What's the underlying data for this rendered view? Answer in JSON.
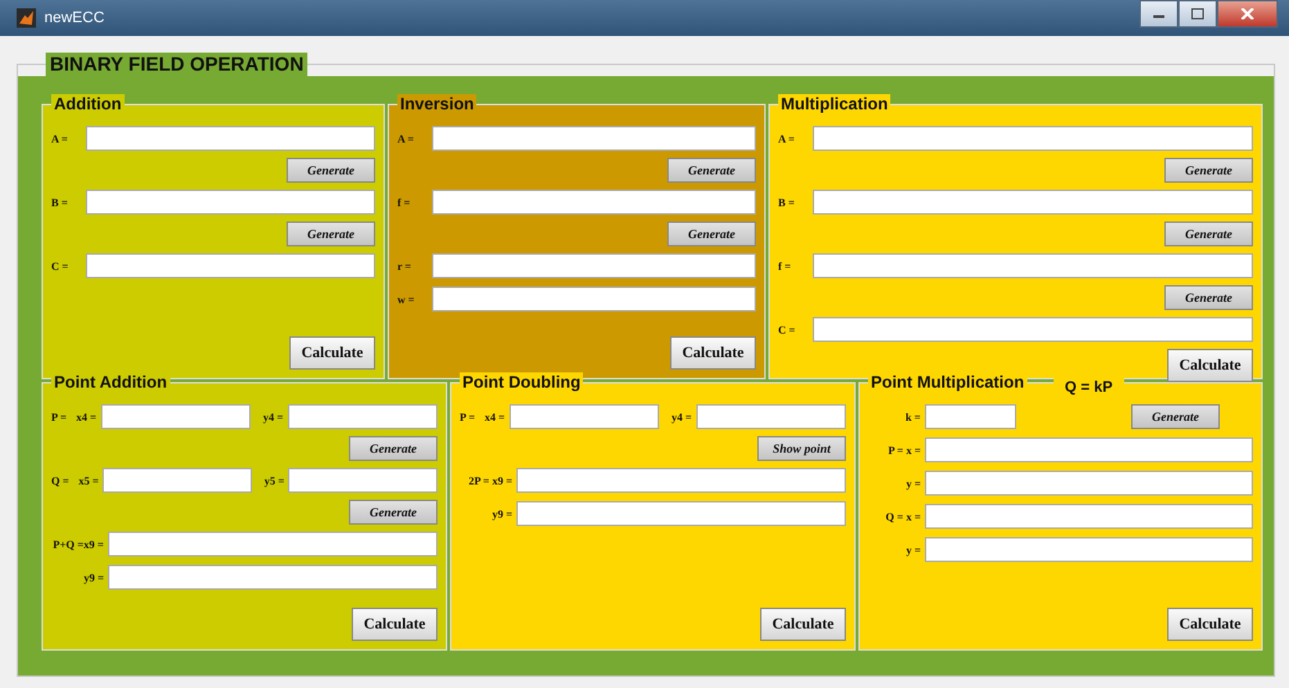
{
  "window": {
    "title": "newECC"
  },
  "frame_title": "BINARY FIELD OPERATION",
  "top_panels": [
    {
      "title": "Addition",
      "color": "#cccc00",
      "rows": [
        {
          "kind": "field",
          "label": "A ="
        },
        {
          "kind": "small-button",
          "label": "Generate"
        },
        {
          "kind": "field",
          "label": "B ="
        },
        {
          "kind": "small-button",
          "label": "Generate"
        },
        {
          "kind": "field",
          "label": "C ="
        },
        {
          "kind": "main-button",
          "label": "Calculate"
        }
      ]
    },
    {
      "title": "Inversion",
      "color": "#cc9900",
      "rows": [
        {
          "kind": "field",
          "label": "A ="
        },
        {
          "kind": "small-button",
          "label": "Generate"
        },
        {
          "kind": "field",
          "label": "f ="
        },
        {
          "kind": "small-button",
          "label": "Generate"
        },
        {
          "kind": "field",
          "label": "r ="
        },
        {
          "kind": "field",
          "label": "w ="
        },
        {
          "kind": "main-button",
          "label": "Calculate"
        }
      ]
    },
    {
      "title": "Multiplication",
      "color": "#ffd700",
      "rows": [
        {
          "kind": "field",
          "label": "A ="
        },
        {
          "kind": "small-button",
          "label": "Generate"
        },
        {
          "kind": "field",
          "label": "B ="
        },
        {
          "kind": "small-button",
          "label": "Generate"
        },
        {
          "kind": "field",
          "label": "f ="
        },
        {
          "kind": "small-button",
          "label": "Generate"
        },
        {
          "kind": "field",
          "label": "C ="
        },
        {
          "kind": "main-button",
          "label": "Calculate"
        }
      ]
    }
  ],
  "bottom_panels": [
    {
      "title": "Point Addition",
      "color": "#cccc00",
      "rows": [
        {
          "kind": "pair",
          "prefix": "P =",
          "label": "x4 =",
          "label2": "y4 ="
        },
        {
          "kind": "small-button",
          "label": "Generate"
        },
        {
          "kind": "pair",
          "prefix": "Q =",
          "label": "x5 =",
          "label2": "y5 ="
        },
        {
          "kind": "small-button",
          "label": "Generate"
        },
        {
          "kind": "field",
          "label": "P+Q =x9 ="
        },
        {
          "kind": "field",
          "label": "y9 ="
        },
        {
          "kind": "main-button",
          "label": "Calculate"
        }
      ]
    },
    {
      "title": "Point Doubling",
      "color": "#ffd700",
      "rows": [
        {
          "kind": "pair",
          "prefix": "P =",
          "label": "x4 =",
          "label2": "y4 ="
        },
        {
          "kind": "small-button",
          "label": "Show point"
        },
        {
          "kind": "field",
          "label": "2P = x9 ="
        },
        {
          "kind": "field",
          "label": "y9 ="
        },
        {
          "kind": "main-button",
          "label": "Calculate"
        }
      ]
    },
    {
      "title": "Point Multiplication",
      "subtitle": "Q = kP",
      "color": "#ffd700",
      "rows": [
        {
          "kind": "field-button",
          "label": "k =",
          "button": "Generate"
        },
        {
          "kind": "field",
          "label": "P = x ="
        },
        {
          "kind": "field",
          "label": "y ="
        },
        {
          "kind": "field",
          "label": "Q = x ="
        },
        {
          "kind": "field",
          "label": "y ="
        },
        {
          "kind": "main-button",
          "label": "Calculate"
        }
      ]
    }
  ]
}
